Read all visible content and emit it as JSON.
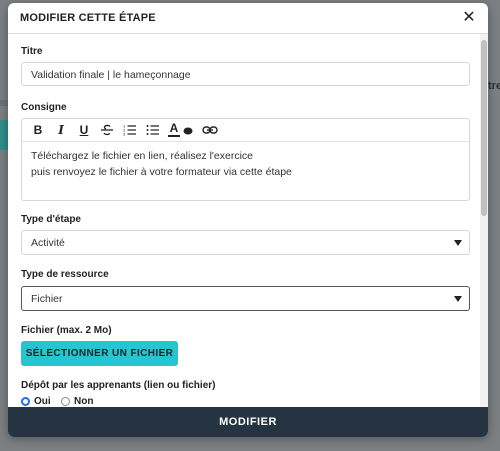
{
  "modal": {
    "title": "MODIFIER CETTE ÉTAPE",
    "close_glyph": "✕"
  },
  "fields": {
    "title_label": "Titre",
    "title_value": "Validation finale | le hameçonnage",
    "instruction_label": "Consigne",
    "instruction_lines": [
      "Téléchargez le fichier en lien, réalisez l'exercice",
      "puis renvoyez le fichier à votre formateur via cette étape"
    ],
    "step_type_label": "Type d'étape",
    "step_type_value": "Activité",
    "resource_type_label": "Type de ressource",
    "resource_type_value": "Fichier",
    "file_label": "Fichier (max. 2 Mo)",
    "file_button": "SÉLECTIONNER UN FICHIER",
    "deposit_label": "Dépôt par les apprenants (lien ou fichier)",
    "deposit_options": [
      "Oui",
      "Non"
    ],
    "deposit_selected": "Oui"
  },
  "toolbar": {
    "bold": "B",
    "italic": "I",
    "underline": "U",
    "strikethrough": "S",
    "text_color": "A",
    "icons": [
      "bold-icon",
      "italic-icon",
      "underline-icon",
      "strikethrough-icon",
      "ordered-list-icon",
      "bullet-list-icon",
      "text-color-icon",
      "highlight-icon",
      "link-icon"
    ]
  },
  "footer": {
    "submit": "MODIFIER"
  },
  "background": {
    "partial_text": "tre"
  },
  "colors": {
    "accent_cyan": "#26c5cf",
    "footer_dark": "#263340",
    "radio_blue": "#1e6fe0"
  }
}
